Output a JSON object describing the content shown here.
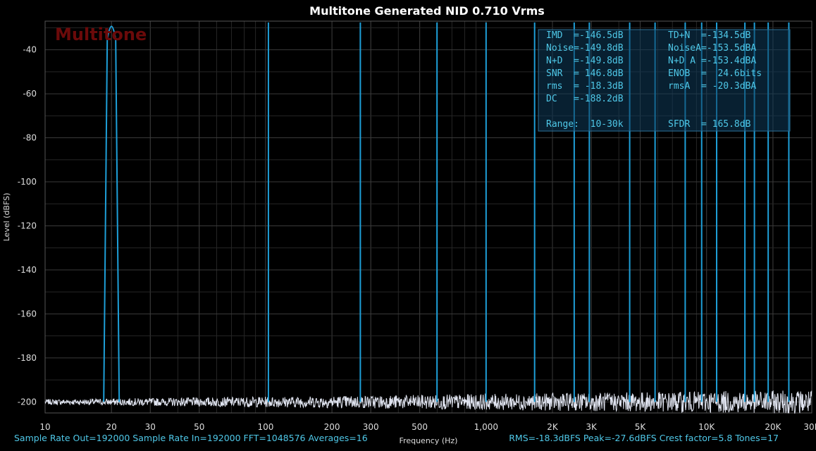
{
  "title": "Multitone Generated NID 0.710 Vrms",
  "watermark": "Multitone",
  "colors": {
    "background": "#000000",
    "grid": "#3a3a3a",
    "tone_line": "#1e9fd8",
    "noise_line": "#e0e4f0",
    "text": "#dddddd",
    "status_text": "#4fc8e8",
    "stats_box": "#0e3a5a",
    "watermark": "#6b0a0a"
  },
  "status_left": "Sample Rate Out=192000  Sample Rate In=192000  FFT=1048576  Averages=16",
  "status_right": "RMS=-18.3dBFS  Peak=-27.6dBFS  Crest factor=5.8  Tones=17",
  "stats": {
    "rows": [
      [
        "IMD  =-146.5dB",
        "TD+N  =-134.5dB"
      ],
      [
        "Noise=-149.8dB",
        "NoiseA=-153.5dBA"
      ],
      [
        "N+D  =-149.8dB",
        "N+D A =-153.4dBA"
      ],
      [
        "SNR  = 146.8dB",
        "ENOB  =  24.6bits"
      ],
      [
        "rms  = -18.3dB",
        "rmsA  = -20.3dBA"
      ],
      [
        "DC   =-188.2dB",
        ""
      ],
      [
        "",
        ""
      ],
      [
        "Range:  10-30k",
        "SFDR  = 165.8dB"
      ]
    ]
  },
  "chart_data": {
    "type": "line",
    "title": "Multitone Generated NID 0.710 Vrms",
    "xlabel": "Frequency (Hz)",
    "ylabel": "Level (dBFS)",
    "x_scale": "log",
    "xlim": [
      10,
      30000
    ],
    "ylim": [
      -205,
      -27
    ],
    "grid": true,
    "x_ticks": [
      10,
      20,
      30,
      50,
      100,
      200,
      300,
      500,
      1000,
      2000,
      3000,
      5000,
      10000,
      20000,
      30000
    ],
    "x_tick_labels": [
      "10",
      "20",
      "30",
      "50",
      "100",
      "200",
      "300",
      "500",
      "1,000",
      "2K",
      "3K",
      "5K",
      "10K",
      "20K",
      "30K"
    ],
    "y_ticks": [
      -40,
      -60,
      -80,
      -100,
      -120,
      -140,
      -160,
      -180,
      -200
    ],
    "y_tick_labels": [
      "-40",
      "-60",
      "-80",
      "-100",
      "-120",
      "-140",
      "-160",
      "-180",
      "-200"
    ],
    "series": [
      {
        "kind": "tones",
        "frequencies": [
          20,
          103,
          269,
          599,
          1000,
          1660,
          2510,
          2940,
          4480,
          5840,
          8000,
          9500,
          11110,
          14920,
          16480,
          19030,
          23610
        ],
        "peak_db": -27.6
      },
      {
        "kind": "noise_floor",
        "level_db": -200
      }
    ]
  }
}
